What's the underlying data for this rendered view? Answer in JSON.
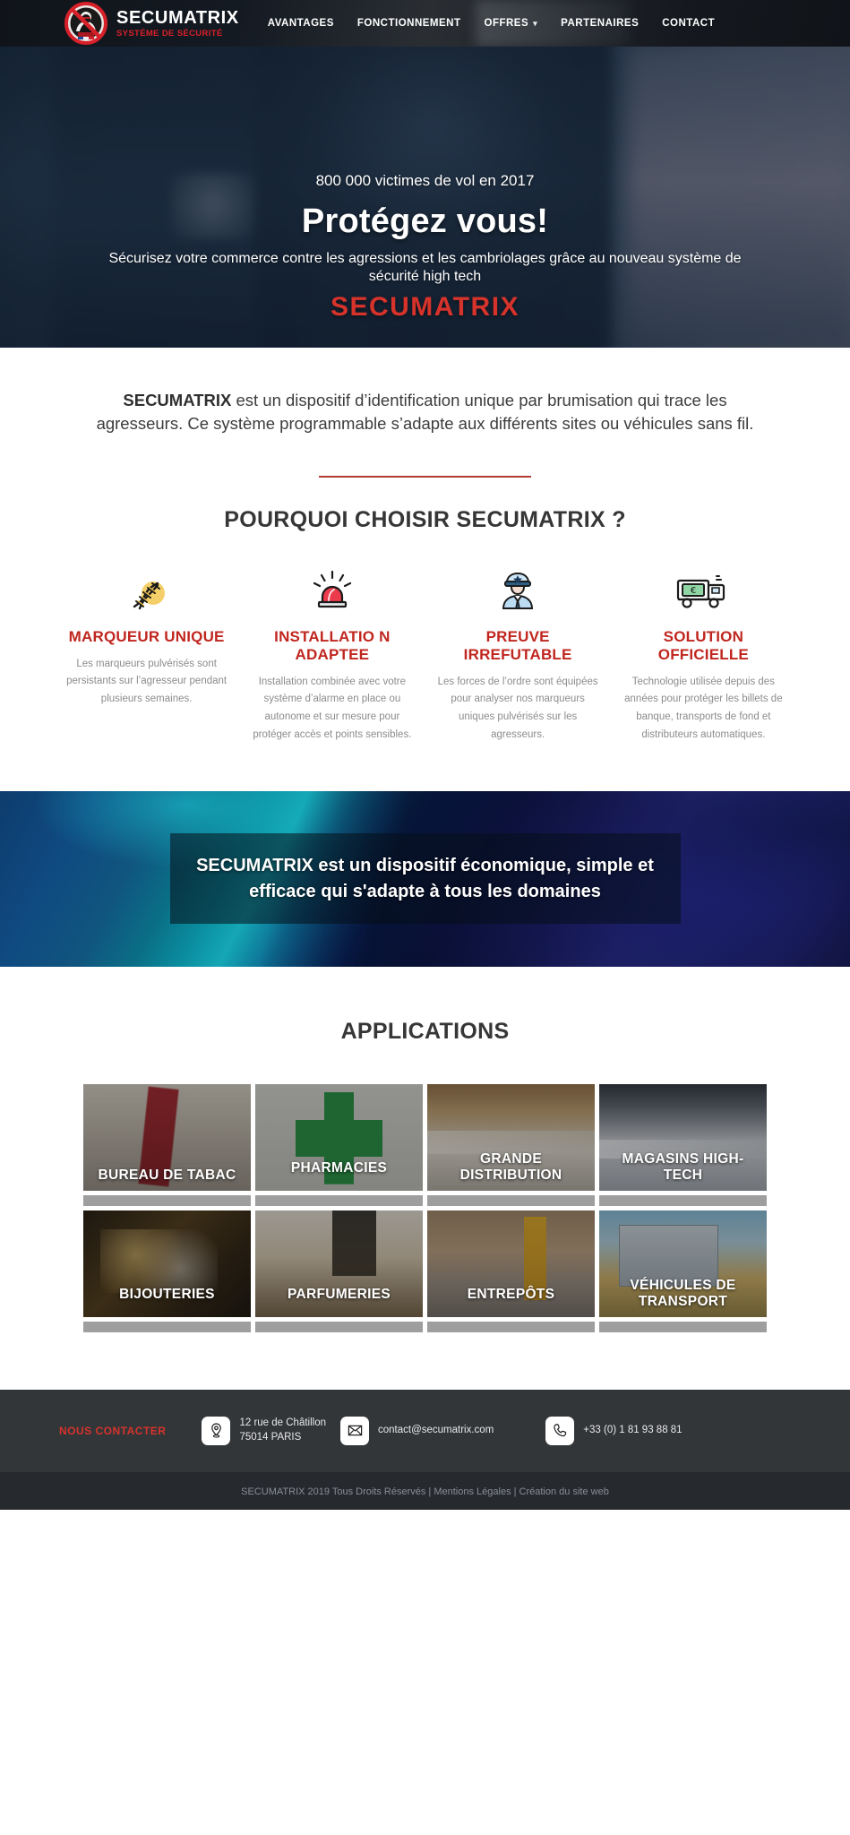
{
  "header": {
    "brand_name": "SECUMATRIX",
    "brand_sub": "SYSTÈME DE SÉCURITÉ",
    "logo_icon": "no-burglar-icon",
    "nav": [
      {
        "label": "AVANTAGES",
        "icon": null
      },
      {
        "label": "FONCTIONNEMENT",
        "icon": null
      },
      {
        "label": "OFFRES",
        "icon": "chevron-down-icon"
      },
      {
        "label": "PARTENAIRES",
        "icon": null
      },
      {
        "label": "CONTACT",
        "icon": null
      }
    ]
  },
  "hero": {
    "kicker": "800 000 victimes de vol en 2017",
    "title": "Protégez vous!",
    "subtitle": "Sécurisez votre commerce contre les agressions et les cambriolages grâce au nouveau système de sécurité high tech",
    "brand": "SECUMATRIX",
    "brand_color": "#d6332b"
  },
  "intro": {
    "lead_bold": "SECUMATRIX",
    "lead_rest": " est un dispositif d’identification unique par brumisation qui trace les agresseurs. Ce système programmable s’adapte aux différents sites ou véhicules sans fil.",
    "divider_color": "#b33a36"
  },
  "why": {
    "title": "POURQUOI CHOISIR SECUMATRIX ?",
    "accent_color": "#c0261f",
    "features": [
      {
        "icon": "dna-helix-icon",
        "title": "MARQUEUR UNIQUE",
        "body": "Les marqueurs pulvérisés sont persistants sur l’agresseur pendant plusieurs semaines."
      },
      {
        "icon": "alarm-siren-icon",
        "title": "INSTALLATIO N ADAPTEE",
        "body": "Installation combinée avec votre système d’alarme en place ou autonome et sur mesure pour protéger accès et points sensibles."
      },
      {
        "icon": "police-officer-icon",
        "title": "PREUVE IRREFUTABLE",
        "body": "Les forces de l’ordre sont équipées pour analyser nos marqueurs uniques pulvérisés sur les agresseurs."
      },
      {
        "icon": "armored-money-truck-icon",
        "title": "SOLUTION OFFICIELLE",
        "body": "Technologie utilisée depuis des années pour protéger les billets de banque, transports de fond et distributeurs automatiques."
      }
    ]
  },
  "banner": {
    "text": "SECUMATRIX est un dispositif économique, simple et efficace qui s'adapte à tous les domaines"
  },
  "applications": {
    "title": "APPLICATIONS",
    "tiles": [
      {
        "label": "BUREAU DE TABAC",
        "image": "tobacco-shop-photo"
      },
      {
        "label": "PHARMACIES",
        "image": "pharmacy-cross-photo"
      },
      {
        "label": "GRANDE DISTRIBUTION",
        "image": "supermarket-aisle-photo"
      },
      {
        "label": "MAGASINS HIGH-TECH",
        "image": "electronics-store-photo"
      },
      {
        "label": "BIJOUTERIES",
        "image": "jewellery-photo"
      },
      {
        "label": "PARFUMERIES",
        "image": "perfume-shelf-photo"
      },
      {
        "label": "ENTREPÔTS",
        "image": "warehouse-photo"
      },
      {
        "label": "VÉHICULES DE TRANSPORT",
        "image": "transport-truck-photo"
      }
    ]
  },
  "footer": {
    "contact_label": "NOUS CONTACTER",
    "contact_label_color": "#d6332b",
    "address_icon": "map-pin-icon",
    "address": "12 rue de Châtillon\n75014 PARIS",
    "email_icon": "envelope-icon",
    "email": "contact@secumatrix.com",
    "phone_icon": "phone-icon",
    "phone": "+33 (0) 1 81 93 88 81",
    "copyright": "SECUMATRIX 2019 Tous Droits Réservés | Mentions Légales | Création du site web"
  }
}
